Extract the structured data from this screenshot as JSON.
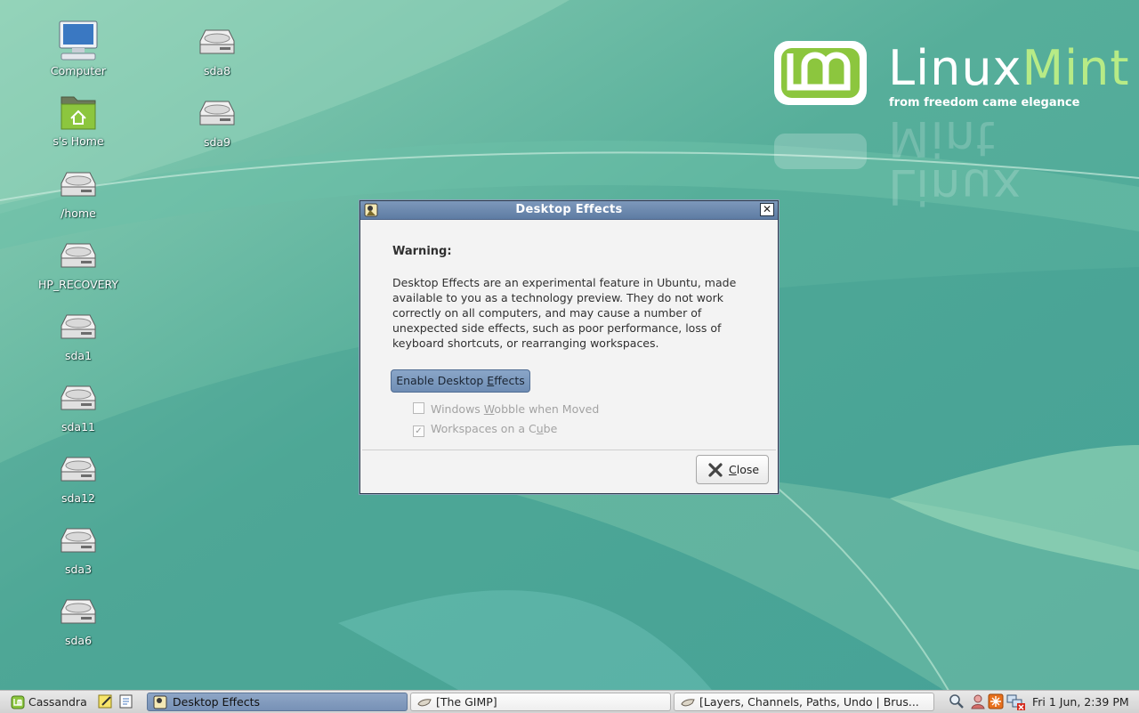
{
  "desktop": {
    "icons": [
      {
        "label": "Computer",
        "icon": "computer-icon"
      },
      {
        "label": "s's Home",
        "icon": "home-folder-icon"
      },
      {
        "label": "/home",
        "icon": "drive-icon"
      },
      {
        "label": "HP_RECOVERY",
        "icon": "drive-icon"
      },
      {
        "label": "sda1",
        "icon": "drive-icon"
      },
      {
        "label": "sda11",
        "icon": "drive-icon"
      },
      {
        "label": "sda12",
        "icon": "drive-icon"
      },
      {
        "label": "sda3",
        "icon": "drive-icon"
      },
      {
        "label": "sda6",
        "icon": "drive-icon"
      },
      {
        "label": "sda8",
        "icon": "drive-icon"
      },
      {
        "label": "sda9",
        "icon": "drive-icon"
      }
    ],
    "brand": {
      "name_part1": "Linux",
      "name_part2": "Mint",
      "tagline": "from freedom came elegance"
    }
  },
  "dialog": {
    "title": "Desktop Effects",
    "warning_heading": "Warning:",
    "warning_body": "Desktop Effects are an experimental feature in Ubuntu, made available to you as a technology preview. They do not work correctly on all computers, and may cause a number of unexpected side effects, such as poor performance, loss of keyboard shortcuts, or rearranging workspaces.",
    "enable_button": {
      "before": "Enable Desktop ",
      "mnemonic": "E",
      "after": "ffects"
    },
    "options": [
      {
        "before": "Windows ",
        "mnemonic": "W",
        "after": "obble when Moved",
        "checked": false,
        "enabled": false
      },
      {
        "before": "Workspaces on a C",
        "mnemonic": "u",
        "after": "be",
        "checked": true,
        "enabled": false
      }
    ],
    "close_button": {
      "mnemonic": "C",
      "after": "lose"
    }
  },
  "taskbar": {
    "menu_label": "Cassandra",
    "tasks": [
      {
        "label": "Desktop Effects",
        "active": true
      },
      {
        "label": "[The GIMP]",
        "active": false
      },
      {
        "label": "[Layers, Channels, Paths, Undo | Brus...",
        "active": false
      }
    ],
    "clock": "Fri  1 Jun,  2:39 PM"
  },
  "colors": {
    "accent": "#7694ba",
    "mint_green": "#8cc63e"
  }
}
